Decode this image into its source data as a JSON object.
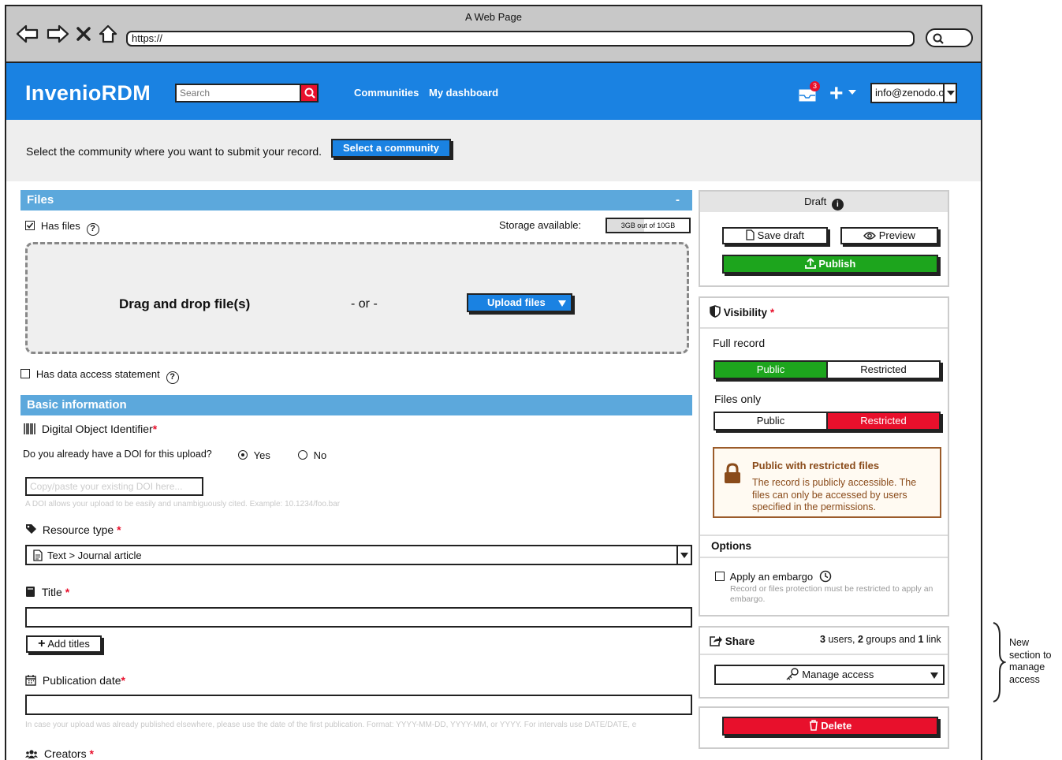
{
  "browser": {
    "window_title": "A Web Page",
    "url": "https://"
  },
  "header": {
    "logo": "InvenioRDM",
    "search_placeholder": "Search",
    "nav": [
      "Communities",
      "My dashboard"
    ],
    "inbox_count": "3",
    "user": "info@zenodo.org"
  },
  "community_bar": {
    "text": "Select the community where you want to submit your record.",
    "button": "Select a community"
  },
  "files": {
    "title": "Files",
    "collapse": "-",
    "has_files": "Has files",
    "storage_label": "Storage available:",
    "storage_value": "3GB out of 10GB",
    "storage_fraction": 0.3,
    "drag_text": "Drag and drop file(s)",
    "or_text": "- or -",
    "upload_button": "Upload files",
    "data_access": "Has data access statement"
  },
  "basic": {
    "title": "Basic information",
    "doi_label": "Digital Object Identifier",
    "doi_question": "Do you already have a DOI for this upload?",
    "yes": "Yes",
    "no": "No",
    "doi_placeholder": "Copy/paste your existing DOI here...",
    "doi_hint": "A DOI allows your upload to be easily and unambiguously cited. Example: 10.1234/foo.bar",
    "resource_type_label": "Resource type",
    "resource_type_value": "Text > Journal article",
    "title_label": "Title",
    "add_titles": "Add titles",
    "pub_date_label": "Publication date",
    "pub_date_hint": "In case your upload was already published elsewhere, please use the date of the first publication. Format: YYYY-MM-DD, YYYY-MM, or YYYY. For intervals use DATE/DATE, e",
    "creators_label": "Creators",
    "required_mark": "*"
  },
  "sidebar": {
    "status": "Draft",
    "save_draft": "Save draft",
    "preview": "Preview",
    "publish": "Publish",
    "visibility": "Visibility",
    "full_record": "Full record",
    "files_only": "Files only",
    "public": "Public",
    "restricted": "Restricted",
    "notice_title": "Public with restricted files",
    "notice_text": "The record is publicly accessible. The files can only be accessed by users specified in the permissions.",
    "options": "Options",
    "embargo": "Apply an embargo",
    "embargo_hint": "Record or files protection must be restricted to apply an embargo.",
    "share": "Share",
    "share_users": "3",
    "share_users_label": "users,",
    "share_groups": "2",
    "share_groups_label": "groups and",
    "share_links": "1",
    "share_links_label": "link",
    "manage_access": "Manage access",
    "delete": "Delete"
  },
  "annotation": {
    "text": "New section to manage access"
  },
  "colors": {
    "brand_blue": "#1a82e2",
    "section_blue": "#5ca8dc",
    "publish_green": "#1da51d",
    "danger_red": "#e8102c",
    "notice_brown": "#8a4b1a"
  }
}
